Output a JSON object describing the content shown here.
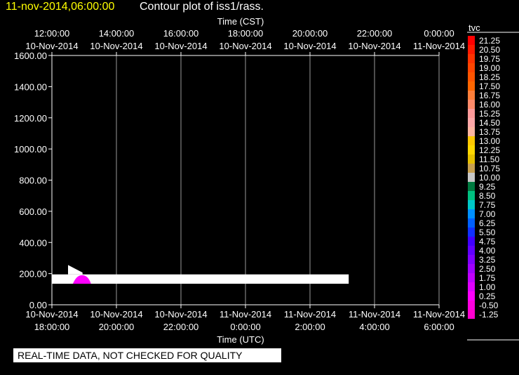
{
  "header": {
    "timestamp": "11-nov-2014,06:00:00",
    "title": "Contour plot of iss1/rass."
  },
  "footer": {
    "notice": "REAL-TIME DATA, NOT CHECKED FOR QUALITY"
  },
  "chart_data": {
    "type": "heatmap",
    "top_axis_label": "Time (CST)",
    "bottom_axis_label": "Time (UTC)",
    "top_ticks": [
      {
        "time": "12:00:00",
        "date": "10-Nov-2014"
      },
      {
        "time": "14:00:00",
        "date": "10-Nov-2014"
      },
      {
        "time": "16:00:00",
        "date": "10-Nov-2014"
      },
      {
        "time": "18:00:00",
        "date": "10-Nov-2014"
      },
      {
        "time": "20:00:00",
        "date": "10-Nov-2014"
      },
      {
        "time": "22:00:00",
        "date": "10-Nov-2014"
      },
      {
        "time": "0:00:00",
        "date": "11-Nov-2014"
      }
    ],
    "bottom_ticks": [
      {
        "date": "10-Nov-2014",
        "time": "18:00:00"
      },
      {
        "date": "10-Nov-2014",
        "time": "20:00:00"
      },
      {
        "date": "10-Nov-2014",
        "time": "22:00:00"
      },
      {
        "date": "11-Nov-2014",
        "time": "0:00:00"
      },
      {
        "date": "11-Nov-2014",
        "time": "2:00:00"
      },
      {
        "date": "11-Nov-2014",
        "time": "4:00:00"
      },
      {
        "date": "11-Nov-2014",
        "time": "6:00:00"
      }
    ],
    "x_range_hours_utc": [
      18,
      30
    ],
    "y_ticks": [
      "0.00",
      "200.00",
      "400.00",
      "600.00",
      "800.00",
      "1000.00",
      "1200.00",
      "1400.00",
      "1600.00"
    ],
    "ylim": [
      0,
      1600
    ],
    "grid": true,
    "data_regions": [
      {
        "shape": "band",
        "color": "#ffffff",
        "x_start_hours": 18.0,
        "x_end_hours": 27.2,
        "y_bottom": 135,
        "y_top": 195
      },
      {
        "shape": "pointer",
        "color": "#ffffff",
        "x_start_hours": 18.5,
        "x_end_hours": 18.95,
        "y_bottom": 195,
        "y_top": 255
      },
      {
        "shape": "blob",
        "color": "#ff00ff",
        "x_center_hours": 18.93,
        "x_half_width_hours": 0.28,
        "y_bottom": 135,
        "y_top": 190
      }
    ],
    "colorbar": {
      "title": "tvc",
      "levels": [
        {
          "label": "21.25",
          "color": "#ff0000"
        },
        {
          "label": "20.50",
          "color": "#ff1a00"
        },
        {
          "label": "19.75",
          "color": "#ff3300"
        },
        {
          "label": "19.00",
          "color": "#ff4500"
        },
        {
          "label": "18.25",
          "color": "#ff5500"
        },
        {
          "label": "17.50",
          "color": "#ff6600"
        },
        {
          "label": "16.75",
          "color": "#ff7f3a"
        },
        {
          "label": "16.00",
          "color": "#ff8a6a"
        },
        {
          "label": "15.25",
          "color": "#ff9a9a"
        },
        {
          "label": "14.50",
          "color": "#ffa8a8"
        },
        {
          "label": "13.75",
          "color": "#ffb6a0"
        },
        {
          "label": "13.00",
          "color": "#ffc800"
        },
        {
          "label": "12.25",
          "color": "#ffd700"
        },
        {
          "label": "11.50",
          "color": "#e6c000"
        },
        {
          "label": "10.75",
          "color": "#c8a050"
        },
        {
          "label": "10.00",
          "color": "#c8c8c8"
        },
        {
          "label": "9.25",
          "color": "#007a40"
        },
        {
          "label": "8.50",
          "color": "#00c080"
        },
        {
          "label": "7.75",
          "color": "#00c8c8"
        },
        {
          "label": "7.00",
          "color": "#0090ff"
        },
        {
          "label": "6.25",
          "color": "#0060ff"
        },
        {
          "label": "5.50",
          "color": "#1030ff"
        },
        {
          "label": "4.75",
          "color": "#4000ff"
        },
        {
          "label": "4.00",
          "color": "#6000ff"
        },
        {
          "label": "3.25",
          "color": "#8000ff"
        },
        {
          "label": "2.50",
          "color": "#a000ff"
        },
        {
          "label": "1.75",
          "color": "#c000ff"
        },
        {
          "label": "1.00",
          "color": "#e000ff"
        },
        {
          "label": "0.25",
          "color": "#ff00ff"
        },
        {
          "label": "-0.50",
          "color": "#ff00e0"
        },
        {
          "label": "-1.25",
          "color": "#ff00d0"
        }
      ]
    }
  }
}
